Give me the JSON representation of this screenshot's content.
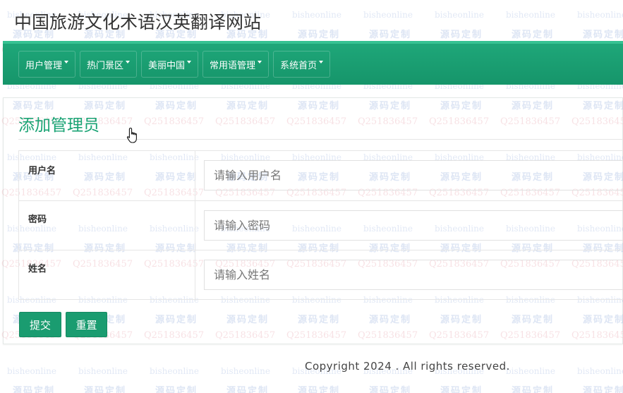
{
  "site": {
    "title": "中国旅游文化术语汉英翻译网站"
  },
  "nav": {
    "items": [
      {
        "label": "用户管理"
      },
      {
        "label": "热门景区"
      },
      {
        "label": "美丽中国"
      },
      {
        "label": "常用语管理"
      },
      {
        "label": "系统首页"
      }
    ]
  },
  "page": {
    "title": "添加管理员"
  },
  "form": {
    "fields": [
      {
        "label": "用户名",
        "placeholder": "请输入用户名",
        "value": ""
      },
      {
        "label": "密码",
        "placeholder": "请输入密码",
        "value": ""
      },
      {
        "label": "姓名",
        "placeholder": "请输入姓名",
        "value": ""
      }
    ],
    "submit_label": "提交",
    "reset_label": "重置"
  },
  "footer": {
    "text": "Copyright 2024 . All rights reserved."
  },
  "watermark": {
    "site": "bisheonline",
    "tag": "源码定制",
    "qq": "Q2518364 57"
  },
  "colors": {
    "brand": "#1a9c70",
    "nav": "#1fa87a",
    "title_accent": "#1aa374"
  },
  "icons": {
    "cursor": "hand-pointer-icon",
    "nav_caret": "caret-down-icon"
  }
}
